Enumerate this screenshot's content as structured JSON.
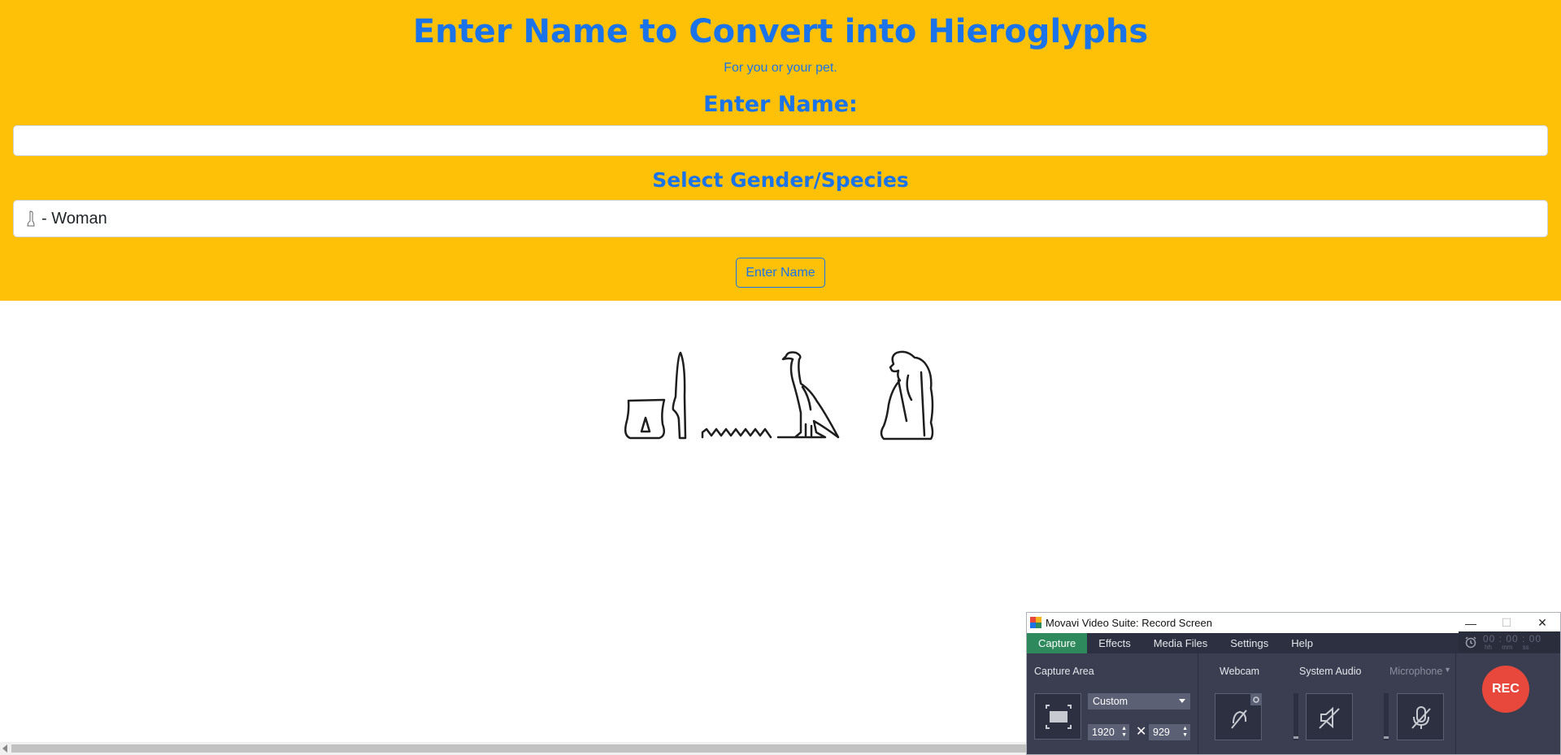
{
  "page": {
    "title": "Enter Name to Convert into Hieroglyphs",
    "subtitle": "For you or your pet.",
    "name_label": "Enter Name:",
    "name_value": "",
    "gender_label": "Select Gender/Species",
    "gender_selected": "- Woman",
    "submit_label": "Enter Name"
  },
  "result": {
    "glyphs": [
      "stool-sign",
      "reed-leaf-sign",
      "water-ripple-sign",
      "vulture-sign",
      "seated-woman-sign"
    ]
  },
  "recorder": {
    "window_title": "Movavi Video Suite: Record Screen",
    "tabs": [
      "Capture",
      "Effects",
      "Media Files",
      "Settings",
      "Help"
    ],
    "active_tab": "Capture",
    "capture_area_label": "Capture Area",
    "capture_mode": "Custom",
    "width": "1920",
    "height": "929",
    "times_symbol": "✕",
    "webcam_label": "Webcam",
    "system_audio_label": "System Audio",
    "microphone_label": "Microphone",
    "rec_label": "REC",
    "timer": "00 : 00 : 00",
    "timer_units": "hh mm ss",
    "accent_color": "#2e8a5c",
    "rec_color": "#e8483b"
  },
  "colors": {
    "header_bg": "#ffc107",
    "heading_text": "#1a73e8"
  }
}
